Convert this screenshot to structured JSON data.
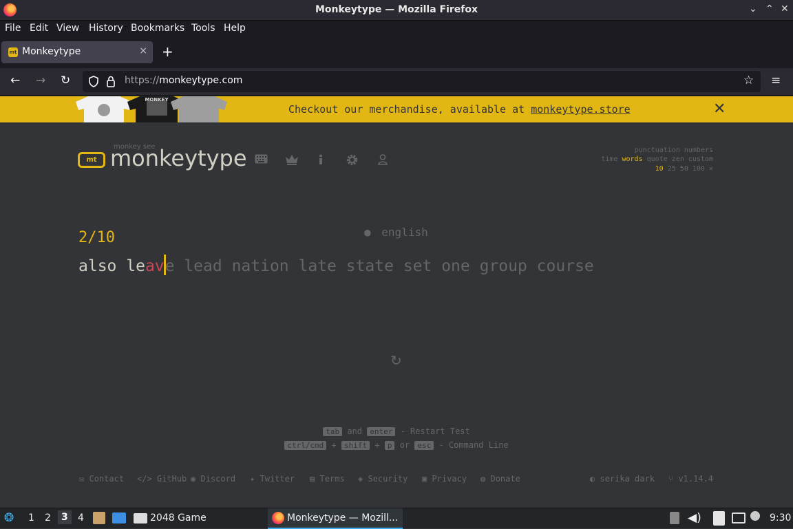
{
  "window": {
    "title": "Monkeytype — Mozilla Firefox",
    "controls": [
      "⌄",
      "⌃",
      "✕"
    ]
  },
  "menu": [
    "File",
    "Edit",
    "View",
    "History",
    "Bookmarks",
    "Tools",
    "Help"
  ],
  "tab": {
    "label": "Monkeytype",
    "favicon": "mt",
    "close": "×",
    "new": "+"
  },
  "nav": {
    "back": "←",
    "forward": "→",
    "reload": "↻",
    "url_scheme": "https://",
    "url_host": "monkeytype.com",
    "bookmark": "☆",
    "menu": "≡"
  },
  "banner": {
    "text_before": "Checkout our merchandise, available at ",
    "link": "monkeytype.store",
    "close": "✕",
    "shirt_text": "MONKEY"
  },
  "logo": {
    "icon_text": "mt",
    "small": "monkey see",
    "big": "monkeytype"
  },
  "config": {
    "row1": "punctuation numbers",
    "modes": [
      "time",
      "words",
      "quote",
      "zen",
      "custom"
    ],
    "active_mode": "words",
    "counts": [
      "10",
      "25",
      "50",
      "100"
    ],
    "active_count": "10"
  },
  "test": {
    "language": "english",
    "counter": "2/10",
    "typed_correct": "also le",
    "typed_error": "av",
    "untyped": "e lead nation late state set one group course"
  },
  "hints": {
    "line1": {
      "k1": "tab",
      "and": "and",
      "k2": "enter",
      "action": "- Restart Test"
    },
    "line2": {
      "k1": "ctrl/cmd",
      "plus1": "+",
      "k2": "shift",
      "plus2": "+",
      "k3": "p",
      "or": "or",
      "k4": "esc",
      "action": "- Command Line"
    }
  },
  "footer": {
    "links": [
      "Contact",
      "GitHub",
      "Discord",
      "Twitter",
      "Terms",
      "Security",
      "Privacy",
      "Donate"
    ],
    "theme": "serika dark",
    "version": "v1.14.4"
  },
  "taskbar": {
    "workspaces": [
      "1",
      "2",
      "3",
      "4"
    ],
    "active_workspace": "3",
    "tasks": [
      "2048 Game",
      "Monkeytype — Mozill..."
    ],
    "clock": "9:30"
  },
  "colors": {
    "accent": "#e2b714",
    "bg": "#323437",
    "text": "#d1d0c5",
    "sub": "#646669",
    "error": "#ca4754"
  }
}
